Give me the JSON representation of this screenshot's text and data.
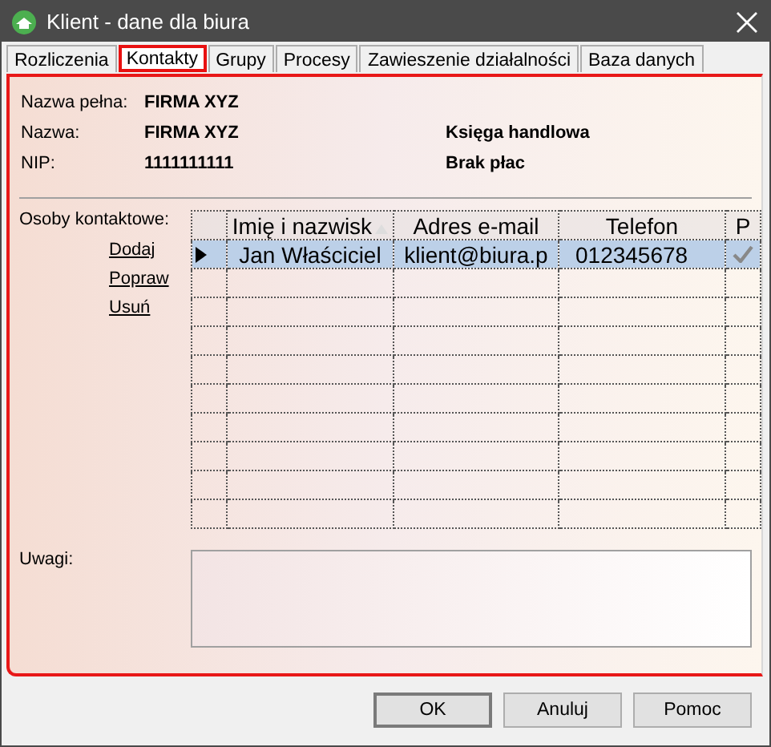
{
  "window": {
    "title": "Klient - dane dla biura"
  },
  "tabs": [
    {
      "label": "Rozliczenia",
      "selected": false
    },
    {
      "label": "Kontakty",
      "selected": true
    },
    {
      "label": "Grupy",
      "selected": false
    },
    {
      "label": "Procesy",
      "selected": false
    },
    {
      "label": "Zawieszenie działalności",
      "selected": false
    },
    {
      "label": "Baza danych",
      "selected": false
    }
  ],
  "info": [
    {
      "label": "Nazwa pełna:",
      "value": "FIRMA XYZ"
    },
    {
      "label": "Nazwa:",
      "value": "FIRMA XYZ",
      "extra": "Księga handlowa"
    },
    {
      "label": "NIP:",
      "value": "1111111111",
      "extra": "Brak płac"
    }
  ],
  "contacts": {
    "label": "Osoby kontaktowe:",
    "links": [
      "Dodaj",
      "Popraw",
      "Usuń"
    ],
    "columns": [
      {
        "label": "Imię i nazwisk",
        "sorted": true
      },
      {
        "label": "Adres e-mail",
        "sorted": false
      },
      {
        "label": "Telefon",
        "sorted": false
      },
      {
        "label": "P",
        "sorted": false
      }
    ],
    "rows": [
      {
        "selected": true,
        "name": "Jan Właściciel",
        "email": "klient@biura.p",
        "phone": "012345678",
        "primary": true
      }
    ]
  },
  "notes": {
    "label": "Uwagi:"
  },
  "buttons": [
    "OK",
    "Anuluj",
    "Pomoc"
  ]
}
